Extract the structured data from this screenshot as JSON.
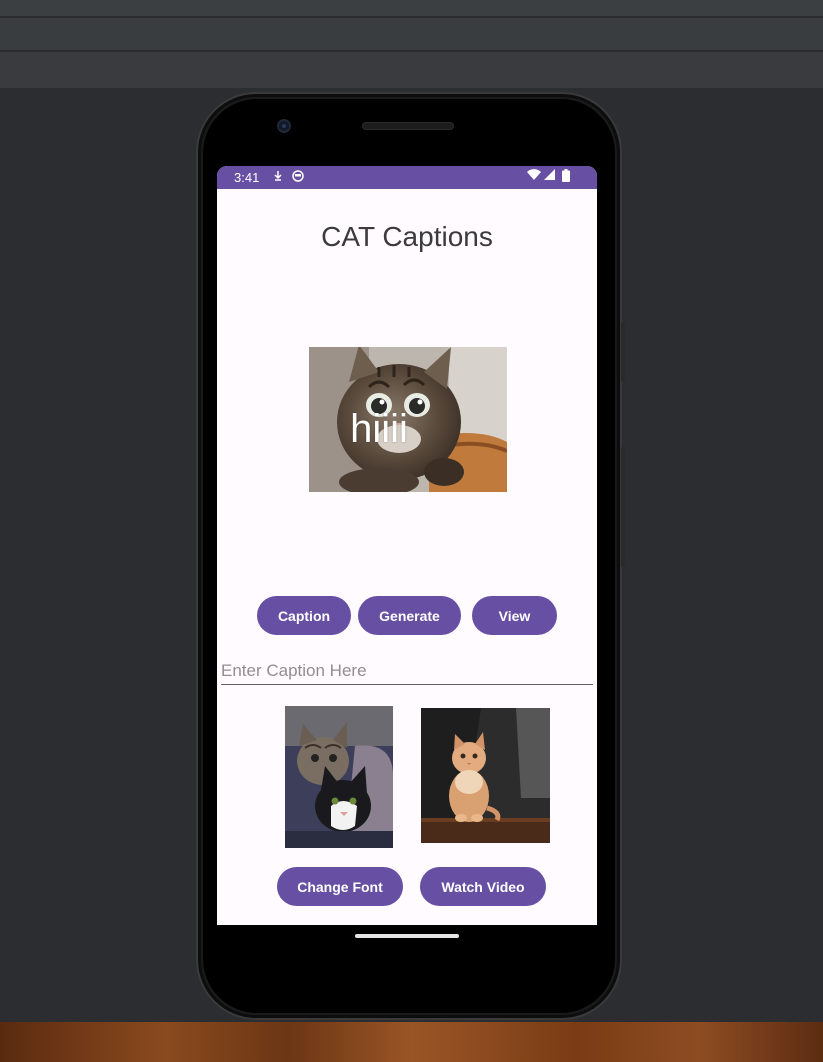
{
  "status_bar": {
    "time": "3:41",
    "icons_left": [
      "download-icon",
      "face-icon"
    ],
    "icons_right": [
      "wifi-icon",
      "signal-icon",
      "battery-icon"
    ],
    "color": "#6750a4"
  },
  "app": {
    "title": "CAT Captions",
    "main_image": {
      "overlay_text": "hiiii",
      "subject": "tabby kitten"
    },
    "buttons": {
      "caption": "Caption",
      "generate": "Generate",
      "view": "View",
      "change_font": "Change Font",
      "watch_video": "Watch Video"
    },
    "caption_field": {
      "placeholder": "Enter Caption Here",
      "value": ""
    },
    "thumbnails": [
      {
        "subject": "tabby and black-white kittens"
      },
      {
        "subject": "orange fluffy kitten"
      }
    ]
  },
  "colors": {
    "accent": "#6750a4",
    "background": "#fffbfe",
    "ide_background": "#2b2d30"
  }
}
